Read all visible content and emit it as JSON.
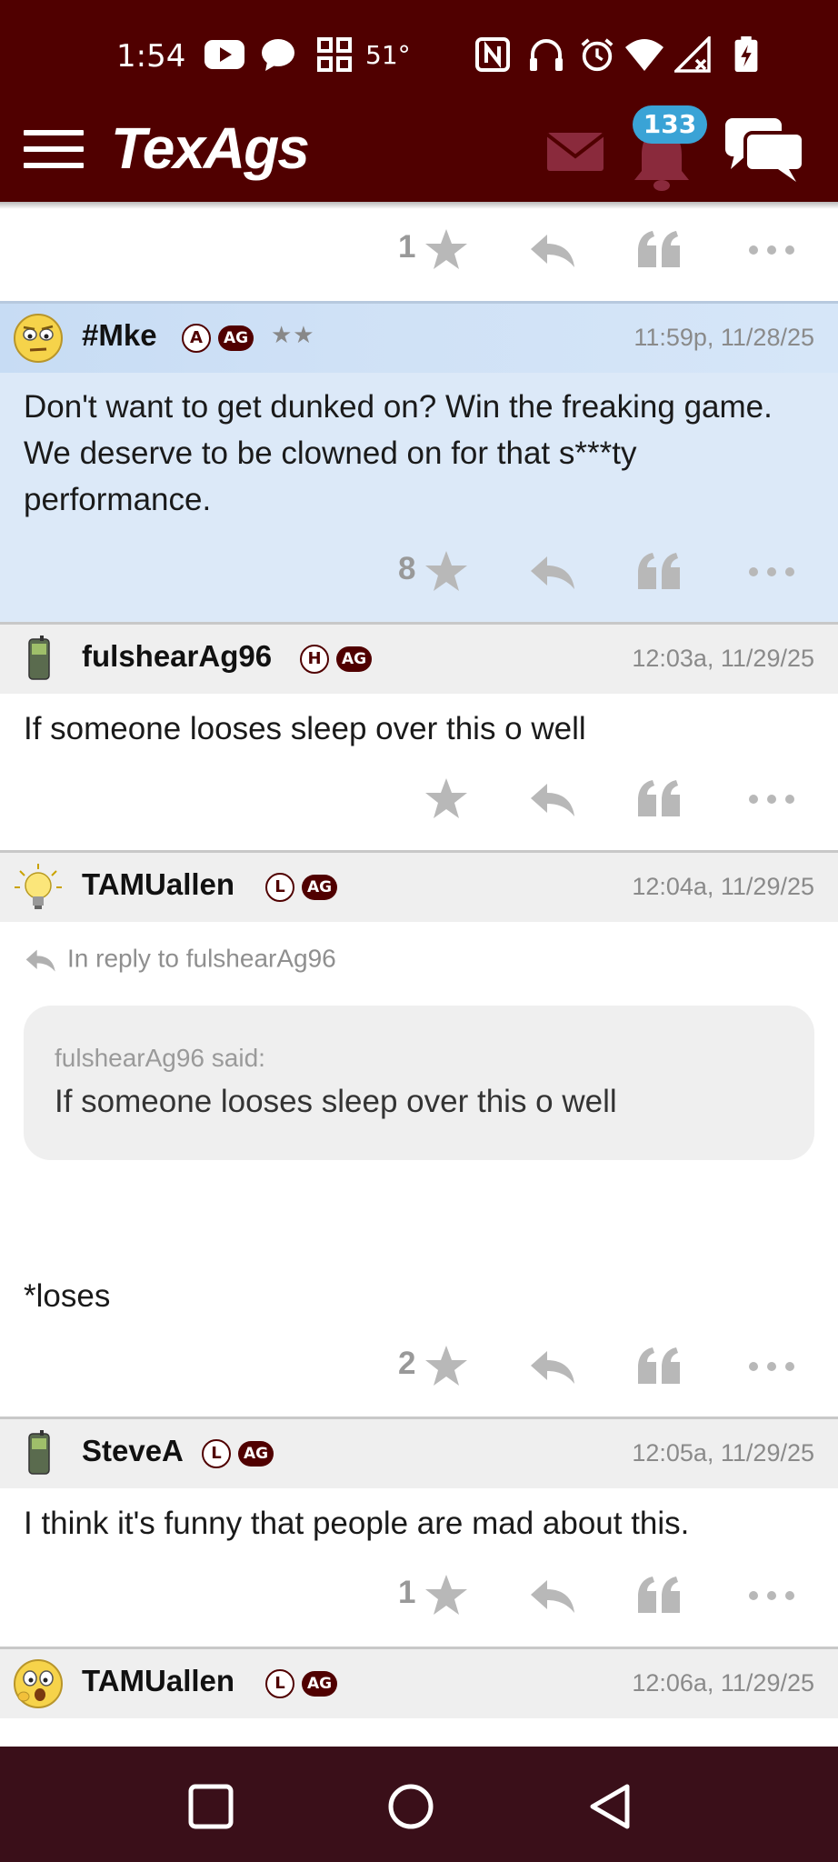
{
  "status_bar": {
    "time": "1:54",
    "temperature": "51°"
  },
  "app_bar": {
    "logo": "TexAgs",
    "notifications_count": "133"
  },
  "top_partial": {
    "star_count": "1"
  },
  "posts": [
    {
      "username": "#Mke",
      "badge": "A",
      "ag": "AG",
      "rank": "★★",
      "timestamp": "11:59p, 11/28/25",
      "body": "Don't want to get dunked on? Win the freaking game. We deserve to be clowned on for that s***ty performance.",
      "star_count": "8"
    },
    {
      "username": "fulshearAg96",
      "badge": "H",
      "ag": "AG",
      "timestamp": "12:03a, 11/29/25",
      "body": "If someone looses sleep over this o well",
      "star_count": ""
    },
    {
      "username": "TAMUallen",
      "badge": "L",
      "ag": "AG",
      "timestamp": "12:04a, 11/29/25",
      "reply_to": "In reply to fulshearAg96",
      "quote_author": "fulshearAg96 said:",
      "quote_text": "If someone looses sleep over this o well",
      "body": "*loses",
      "star_count": "2"
    },
    {
      "username": "SteveA",
      "badge": "L",
      "ag": "AG",
      "timestamp": "12:05a, 11/29/25",
      "body": "I think it's funny that people are mad about this.",
      "star_count": "1"
    },
    {
      "username": "TAMUallen",
      "badge": "L",
      "ag": "AG",
      "timestamp": "12:06a, 11/29/25"
    }
  ],
  "colors": {
    "maroon": "#500000",
    "highlight": "#d6e6f8",
    "badge_blue": "#3aa3d6"
  },
  "icons": [
    "menu-icon",
    "mail-icon",
    "bell-icon",
    "chat-icon",
    "star-icon",
    "reply-icon",
    "quote-icon",
    "more-icon"
  ]
}
